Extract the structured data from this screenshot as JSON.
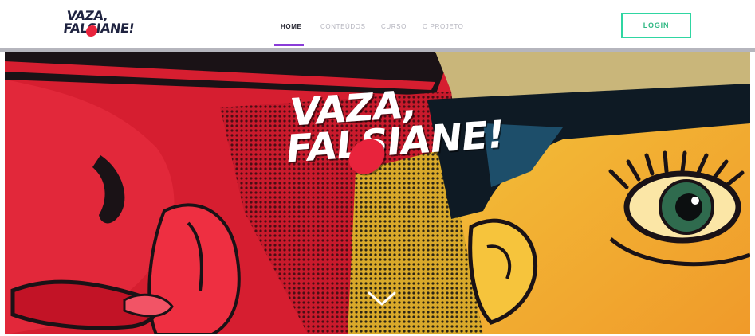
{
  "brand": {
    "logo_line1": "VAZA,",
    "logo_line2": "FALSIANE!"
  },
  "nav": {
    "items": [
      {
        "label": "HOME",
        "active": true
      },
      {
        "label": "CONTEÚDOS",
        "active": false
      },
      {
        "label": "CURSO",
        "active": false
      },
      {
        "label": "O PROJETO",
        "active": false
      }
    ]
  },
  "header": {
    "login_label": "LOGIN"
  },
  "hero": {
    "title_line1": "VAZA,",
    "title_line2": "FALSIANE!",
    "scroll_icon": "chevron-down-icon"
  },
  "colors": {
    "brand_dark": "#1f2340",
    "accent_red": "#e8233c",
    "nav_active_underline": "#8a3cd8",
    "login_border": "#2fd6a2",
    "hero_red": "#d61e30",
    "hero_yellow": "#f2b431"
  }
}
